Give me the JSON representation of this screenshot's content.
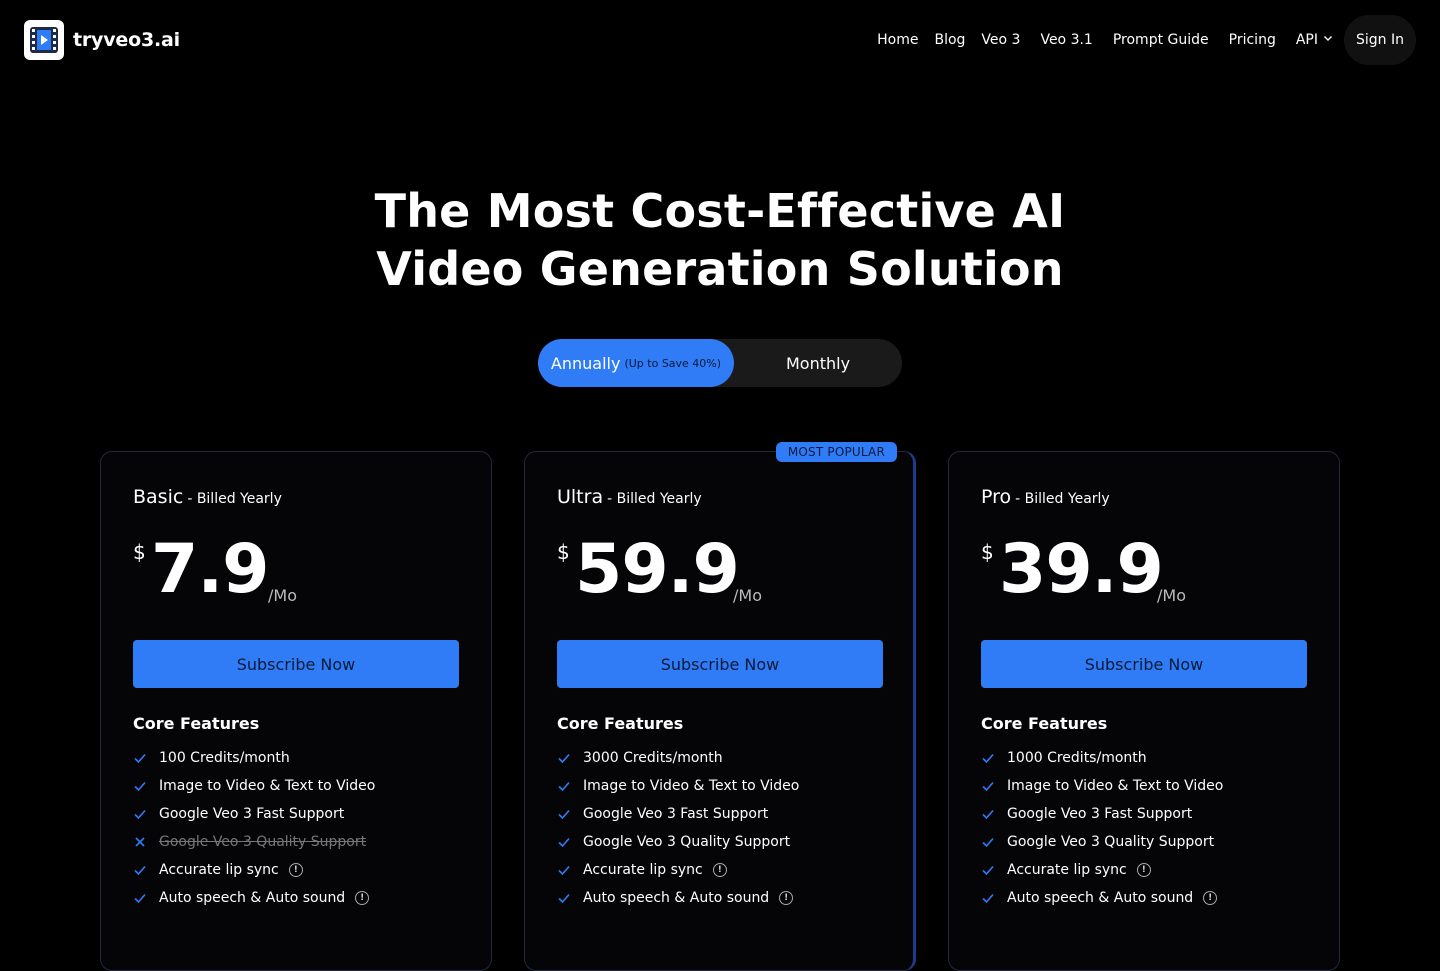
{
  "header": {
    "logo_text": "tryveo3.ai",
    "nav": [
      "Home",
      "Blog",
      "Veo 3",
      "Veo 3.1",
      "Prompt Guide",
      "Pricing",
      "API"
    ],
    "signin_label": "Sign In"
  },
  "hero": {
    "title_line1": "The Most Cost-Effective AI",
    "title_line2": "Video Generation Solution"
  },
  "billing_toggle": {
    "annual_label": "Annually",
    "annual_note": "(Up to Save 40%)",
    "monthly_label": "Monthly",
    "selected": "annual"
  },
  "colors": {
    "accent": "#2f7cf6",
    "background": "#000000"
  },
  "plans": [
    {
      "name": "Basic",
      "billing": "- Billed Yearly",
      "currency": "$",
      "price": "7.9",
      "per": "/Mo",
      "cta": "Subscribe Now",
      "features_title": "Core Features",
      "features": [
        {
          "text": "100 Credits/month",
          "included": true,
          "info": false
        },
        {
          "text": "Image to Video & Text to Video",
          "included": true,
          "info": false
        },
        {
          "text": "Google Veo 3 Fast Support",
          "included": true,
          "info": false
        },
        {
          "text": "Google Veo 3 Quality Support",
          "included": false,
          "info": false
        },
        {
          "text": "Accurate lip sync",
          "included": true,
          "info": true
        },
        {
          "text": "Auto speech & Auto sound",
          "included": true,
          "info": true
        }
      ]
    },
    {
      "name": "Ultra",
      "billing": "- Billed Yearly",
      "currency": "$",
      "price": "59.9",
      "per": "/Mo",
      "badge": "MOST POPULAR",
      "cta": "Subscribe Now",
      "features_title": "Core Features",
      "features": [
        {
          "text": "3000 Credits/month",
          "included": true,
          "info": false
        },
        {
          "text": "Image to Video & Text to Video",
          "included": true,
          "info": false
        },
        {
          "text": "Google Veo 3 Fast Support",
          "included": true,
          "info": false
        },
        {
          "text": "Google Veo 3 Quality Support",
          "included": true,
          "info": false
        },
        {
          "text": "Accurate lip sync",
          "included": true,
          "info": true
        },
        {
          "text": "Auto speech & Auto sound",
          "included": true,
          "info": true
        }
      ]
    },
    {
      "name": "Pro",
      "billing": "- Billed Yearly",
      "currency": "$",
      "price": "39.9",
      "per": "/Mo",
      "cta": "Subscribe Now",
      "features_title": "Core Features",
      "features": [
        {
          "text": "1000 Credits/month",
          "included": true,
          "info": false
        },
        {
          "text": "Image to Video & Text to Video",
          "included": true,
          "info": false
        },
        {
          "text": "Google Veo 3 Fast Support",
          "included": true,
          "info": false
        },
        {
          "text": "Google Veo 3 Quality Support",
          "included": true,
          "info": false
        },
        {
          "text": "Accurate lip sync",
          "included": true,
          "info": true
        },
        {
          "text": "Auto speech & Auto sound",
          "included": true,
          "info": true
        }
      ]
    }
  ]
}
